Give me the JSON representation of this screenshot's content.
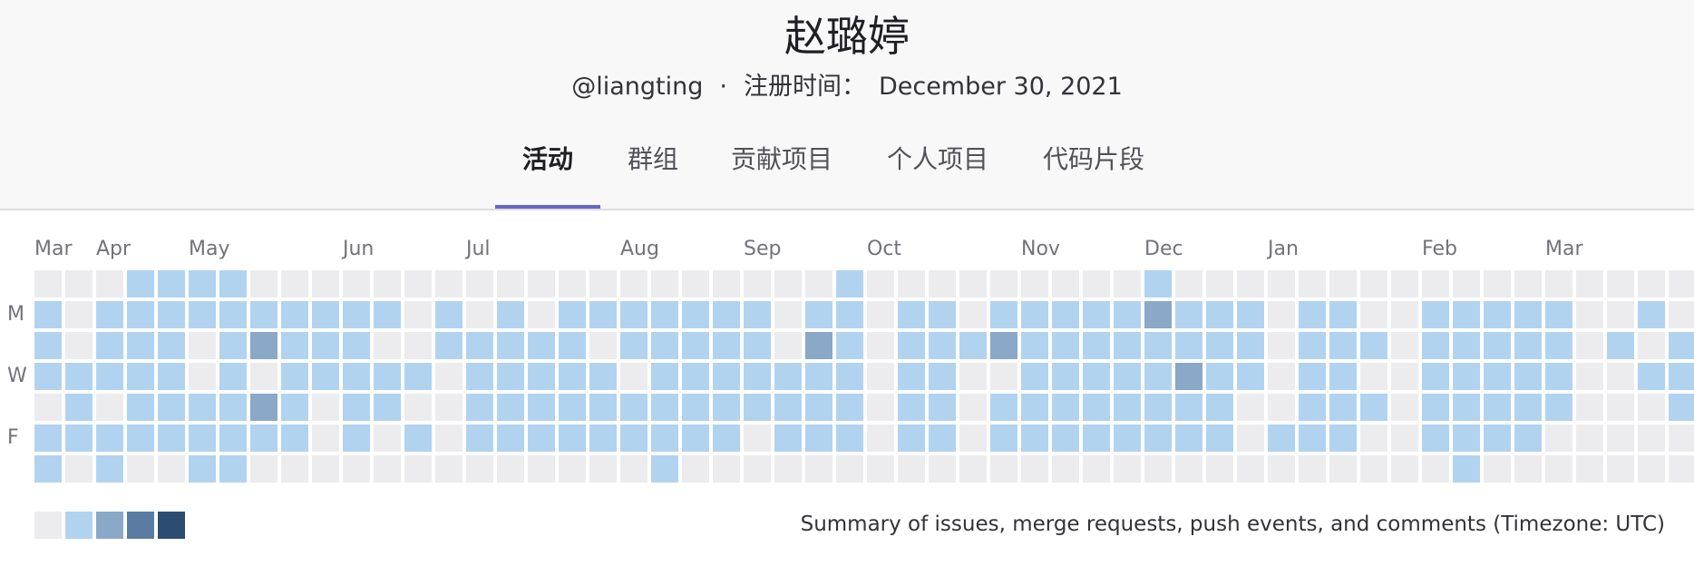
{
  "profile": {
    "name": "赵璐婷",
    "username": "@liangting",
    "separator": "·",
    "registered_label": "注册时间：",
    "registered_date": "December 30, 2021"
  },
  "tabs": [
    {
      "label": "活动",
      "active": true
    },
    {
      "label": "群组",
      "active": false
    },
    {
      "label": "贡献项目",
      "active": false
    },
    {
      "label": "个人项目",
      "active": false
    },
    {
      "label": "代码片段",
      "active": false
    }
  ],
  "calendar": {
    "months": [
      {
        "label": "Mar",
        "week": 0
      },
      {
        "label": "Apr",
        "week": 2
      },
      {
        "label": "May",
        "week": 5
      },
      {
        "label": "Jun",
        "week": 10
      },
      {
        "label": "Jul",
        "week": 14
      },
      {
        "label": "Aug",
        "week": 19
      },
      {
        "label": "Sep",
        "week": 23
      },
      {
        "label": "Oct",
        "week": 27
      },
      {
        "label": "Nov",
        "week": 32
      },
      {
        "label": "Dec",
        "week": 36
      },
      {
        "label": "Jan",
        "week": 40
      },
      {
        "label": "Feb",
        "week": 45
      },
      {
        "label": "Mar",
        "week": 49
      }
    ],
    "day_labels": [
      {
        "label": "M",
        "row": 1
      },
      {
        "label": "W",
        "row": 3
      },
      {
        "label": "F",
        "row": 5
      }
    ],
    "rows": [
      "000111100000000000000000000000000000000000000000000010000000001000000000000000000000000000000000000000000000000000000",
      "1.1111111111.1.11111111.1111.11111111111.11111.1111.11",
      "",
      "",
      "",
      "",
      ""
    ],
    "levels": [
      "0001111000000000000000000000000000000000000000000000100000000010000000000000000000000000000000000000000000000000",
      "10111111111101010111111101101111212211101111101111101111101",
      "0111101211111111110101111111111110111111111111111111111",
      "1111101011111111111111111111111111111111111111111111111111",
      "0101111210111111111111111111111111111111111111111111111111111",
      "1111111101101111111111111111111111111111111111111111111111111",
      "1010011000000000000100000000000000000000000000001000000000000"
    ],
    "grid": [
      [
        0,
        0,
        0,
        1,
        1,
        1,
        1,
        0,
        0,
        0,
        0,
        0,
        0,
        0,
        0,
        0,
        0,
        0,
        0,
        0,
        0,
        0,
        0,
        0,
        0,
        0,
        1,
        0,
        0,
        0,
        0,
        0,
        0,
        0,
        0,
        0,
        1,
        0,
        0,
        0,
        0,
        0,
        0,
        0,
        0,
        0,
        0,
        0,
        0,
        0,
        0,
        0,
        0,
        0
      ],
      [
        1,
        0,
        1,
        1,
        1,
        1,
        1,
        1,
        1,
        1,
        1,
        1,
        0,
        1,
        0,
        1,
        0,
        1,
        1,
        1,
        1,
        1,
        1,
        1,
        0,
        1,
        1,
        0,
        1,
        1,
        0,
        1,
        1,
        1,
        1,
        1,
        2,
        1,
        1,
        1,
        0,
        1,
        1,
        0,
        0,
        1,
        1,
        1,
        1,
        1,
        0,
        0,
        1,
        0
      ],
      [
        1,
        0,
        1,
        1,
        1,
        0,
        1,
        2,
        1,
        1,
        1,
        0,
        0,
        1,
        1,
        1,
        1,
        1,
        0,
        1,
        1,
        1,
        1,
        1,
        0,
        2,
        1,
        0,
        1,
        1,
        1,
        2,
        1,
        1,
        1,
        1,
        1,
        1,
        1,
        1,
        0,
        1,
        1,
        1,
        0,
        1,
        1,
        1,
        1,
        1,
        0,
        1,
        0,
        1
      ],
      [
        1,
        1,
        1,
        1,
        1,
        0,
        1,
        0,
        1,
        1,
        1,
        1,
        1,
        0,
        1,
        1,
        1,
        1,
        1,
        0,
        1,
        1,
        1,
        1,
        1,
        1,
        1,
        0,
        1,
        1,
        0,
        0,
        1,
        1,
        1,
        1,
        1,
        2,
        1,
        1,
        0,
        1,
        1,
        0,
        0,
        1,
        1,
        1,
        1,
        1,
        0,
        0,
        1,
        1
      ],
      [
        0,
        1,
        0,
        1,
        1,
        1,
        1,
        2,
        1,
        0,
        1,
        1,
        0,
        0,
        1,
        1,
        1,
        1,
        1,
        1,
        1,
        1,
        1,
        1,
        1,
        1,
        1,
        0,
        1,
        1,
        0,
        1,
        1,
        1,
        1,
        1,
        1,
        1,
        1,
        0,
        0,
        1,
        1,
        1,
        0,
        1,
        1,
        1,
        1,
        1,
        0,
        0,
        0,
        1
      ],
      [
        1,
        1,
        1,
        1,
        1,
        1,
        1,
        1,
        1,
        0,
        1,
        0,
        1,
        0,
        1,
        1,
        1,
        1,
        1,
        1,
        1,
        1,
        1,
        0,
        1,
        1,
        1,
        0,
        1,
        1,
        0,
        1,
        1,
        1,
        1,
        1,
        1,
        1,
        1,
        0,
        1,
        1,
        1,
        0,
        0,
        1,
        1,
        1,
        1,
        0,
        0,
        0,
        0,
        0
      ],
      [
        1,
        0,
        1,
        0,
        0,
        1,
        1,
        0,
        0,
        0,
        0,
        0,
        0,
        0,
        0,
        0,
        0,
        0,
        0,
        0,
        1,
        0,
        0,
        0,
        0,
        0,
        0,
        0,
        0,
        0,
        0,
        0,
        0,
        0,
        0,
        0,
        0,
        0,
        0,
        0,
        0,
        0,
        0,
        0,
        0,
        0,
        1,
        0,
        0,
        0,
        0,
        0,
        0,
        0
      ]
    ],
    "level_colors": [
      "#ececef",
      "#b1d3f0",
      "#8aa8c8",
      "#5a7ca3",
      "#2d4c72"
    ]
  },
  "legend": {
    "levels": [
      0,
      1,
      2,
      3,
      4
    ]
  },
  "summary": "Summary of issues, merge requests, push events, and comments (Timezone: UTC)"
}
